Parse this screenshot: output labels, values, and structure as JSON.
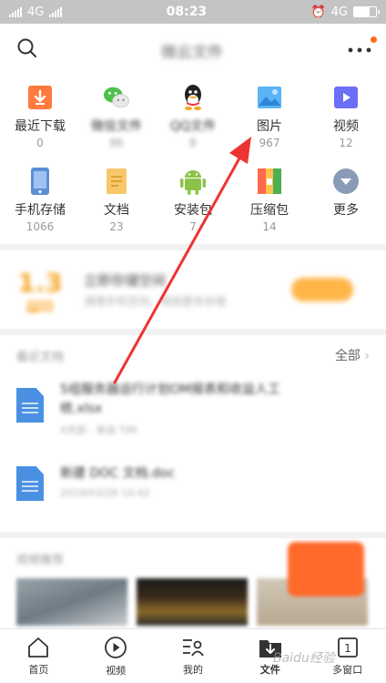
{
  "status_bar": {
    "carrier_left": "4G",
    "time": "08:23",
    "network_right": "4G"
  },
  "header": {
    "title": "微云文件"
  },
  "categories": [
    {
      "label": "最近下载",
      "count": "0",
      "icon": "download-icon",
      "blurred": false
    },
    {
      "label": "微信文件",
      "count": "86",
      "icon": "wechat-icon",
      "blurred": true
    },
    {
      "label": "QQ文件",
      "count": "8",
      "icon": "qq-icon",
      "blurred": true
    },
    {
      "label": "图片",
      "count": "967",
      "icon": "image-icon",
      "blurred": false
    },
    {
      "label": "视频",
      "count": "12",
      "icon": "video-icon",
      "blurred": false
    },
    {
      "label": "手机存储",
      "count": "1066",
      "icon": "phone-storage-icon",
      "blurred": false
    },
    {
      "label": "文档",
      "count": "23",
      "icon": "document-icon",
      "blurred": false
    },
    {
      "label": "安装包",
      "count": "7",
      "icon": "android-icon",
      "blurred": false
    },
    {
      "label": "压缩包",
      "count": "14",
      "icon": "zip-icon",
      "blurred": false
    },
    {
      "label": "更多",
      "count": "",
      "icon": "chevron-down-icon",
      "blurred": false
    }
  ],
  "promo": {
    "number": "1.3",
    "badge": "GB",
    "title": "立即存储空间",
    "subtitle": "清理手机空间，释放更多存储"
  },
  "recent": {
    "title": "最近文档",
    "all_label": "全部",
    "files": [
      {
        "name": "5组服务器运行计划OM报表和收益人工",
        "name2": "统.xlsx",
        "meta": "4天前 · 来自 TIM"
      },
      {
        "name": "新建 DOC 文档.doc",
        "name2": "",
        "meta": "2019/03/28 10:42"
      }
    ]
  },
  "videos": {
    "title": "视频推荐"
  },
  "bottom_nav": [
    {
      "label": "首页",
      "icon": "home-icon",
      "active": false
    },
    {
      "label": "视频",
      "icon": "play-icon",
      "active": false
    },
    {
      "label": "我的",
      "icon": "profile-icon",
      "active": false
    },
    {
      "label": "文件",
      "icon": "file-download-icon",
      "active": true
    },
    {
      "label": "多窗口",
      "icon": "multi-window-icon",
      "active": false
    }
  ],
  "multi_window_count": "1",
  "watermark": "Baidu经验",
  "colors": {
    "accent": "#ff6b1a",
    "arrow": "#ee3333",
    "doc_blue": "#4a90e2"
  }
}
